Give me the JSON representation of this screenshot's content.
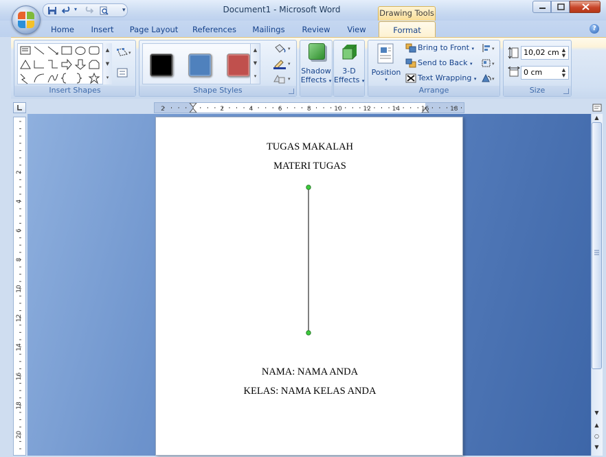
{
  "window": {
    "title": "Document1 - Microsoft Word",
    "context_tab_group": "Drawing Tools"
  },
  "tabs": [
    {
      "label": "Home"
    },
    {
      "label": "Insert"
    },
    {
      "label": "Page Layout"
    },
    {
      "label": "References"
    },
    {
      "label": "Mailings"
    },
    {
      "label": "Review"
    },
    {
      "label": "View"
    },
    {
      "label": "Format"
    }
  ],
  "active_tab": "Format",
  "ribbon": {
    "insert_shapes": {
      "label": "Insert Shapes"
    },
    "shape_styles": {
      "label": "Shape Styles",
      "swatch_colors": [
        "#000000",
        "#4f81bd",
        "#c0504d"
      ]
    },
    "shadow_effects": {
      "label_line1": "Shadow",
      "label_line2": "Effects"
    },
    "three_d_effects": {
      "label_line1": "3-D",
      "label_line2": "Effects"
    },
    "arrange": {
      "label": "Arrange",
      "position": "Position",
      "bring_to_front": "Bring to Front",
      "send_to_back": "Send to Back",
      "text_wrapping": "Text Wrapping"
    },
    "size": {
      "label": "Size",
      "height_value": "10,02 cm",
      "width_value": "0 cm"
    }
  },
  "ruler": {
    "horizontal_labels": [
      "2",
      "2",
      "4",
      "6",
      "8",
      "10",
      "12",
      "14",
      "16",
      "18"
    ],
    "vertical_labels": [
      "2",
      "4",
      "6",
      "8",
      "10",
      "12",
      "14",
      "16",
      "18",
      "20"
    ]
  },
  "document": {
    "line1": "TUGAS MAKALAH",
    "line2": "MATERI TUGAS",
    "line3": "NAMA: NAMA ANDA",
    "line4": "KELAS: NAMA KELAS ANDA"
  },
  "colors": {
    "accent": "#15428b",
    "format_tab": "#fdf1cf",
    "selection_handle": "#3ccc3c"
  }
}
